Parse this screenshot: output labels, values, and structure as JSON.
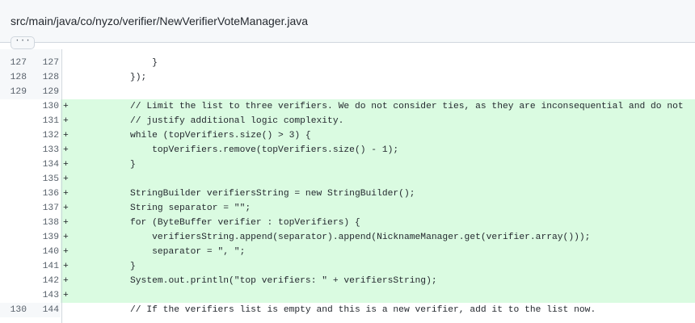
{
  "file": {
    "path": "src/main/java/co/nyzo/verifier/NewVerifierVoteManager.java",
    "expand_label": "···"
  },
  "lines": [
    {
      "type": "context",
      "old": "127",
      "new": "127",
      "sign": "",
      "code": "            }"
    },
    {
      "type": "context",
      "old": "128",
      "new": "128",
      "sign": "",
      "code": "        });"
    },
    {
      "type": "context",
      "old": "129",
      "new": "129",
      "sign": "",
      "code": ""
    },
    {
      "type": "add",
      "old": "",
      "new": "130",
      "sign": "+",
      "code": "        // Limit the list to three verifiers. We do not consider ties, as they are inconsequential and do not"
    },
    {
      "type": "add",
      "old": "",
      "new": "131",
      "sign": "+",
      "code": "        // justify additional logic complexity."
    },
    {
      "type": "add",
      "old": "",
      "new": "132",
      "sign": "+",
      "code": "        while (topVerifiers.size() > 3) {"
    },
    {
      "type": "add",
      "old": "",
      "new": "133",
      "sign": "+",
      "code": "            topVerifiers.remove(topVerifiers.size() - 1);"
    },
    {
      "type": "add",
      "old": "",
      "new": "134",
      "sign": "+",
      "code": "        }"
    },
    {
      "type": "add",
      "old": "",
      "new": "135",
      "sign": "+",
      "code": ""
    },
    {
      "type": "add",
      "old": "",
      "new": "136",
      "sign": "+",
      "code": "        StringBuilder verifiersString = new StringBuilder();"
    },
    {
      "type": "add",
      "old": "",
      "new": "137",
      "sign": "+",
      "code": "        String separator = \"\";"
    },
    {
      "type": "add",
      "old": "",
      "new": "138",
      "sign": "+",
      "code": "        for (ByteBuffer verifier : topVerifiers) {"
    },
    {
      "type": "add",
      "old": "",
      "new": "139",
      "sign": "+",
      "code": "            verifiersString.append(separator).append(NicknameManager.get(verifier.array()));"
    },
    {
      "type": "add",
      "old": "",
      "new": "140",
      "sign": "+",
      "code": "            separator = \", \";"
    },
    {
      "type": "add",
      "old": "",
      "new": "141",
      "sign": "+",
      "code": "        }"
    },
    {
      "type": "add",
      "old": "",
      "new": "142",
      "sign": "+",
      "code": "        System.out.println(\"top verifiers: \" + verifiersString);"
    },
    {
      "type": "add",
      "old": "",
      "new": "143",
      "sign": "+",
      "code": ""
    },
    {
      "type": "context",
      "old": "130",
      "new": "144",
      "sign": "",
      "code": "        // If the verifiers list is empty and this is a new verifier, add it to the list now."
    }
  ]
}
